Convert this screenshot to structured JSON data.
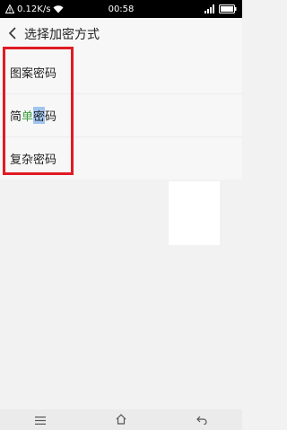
{
  "status_bar": {
    "speed": "0.12K/s",
    "time": "00:58"
  },
  "header": {
    "title": "选择加密方式"
  },
  "options": [
    {
      "label": "图案密码"
    },
    {
      "label_part1": "简",
      "label_part2": "单",
      "label_part3": "密",
      "label_part4": "码"
    },
    {
      "label": "复杂密码"
    }
  ],
  "colors": {
    "annotation_box": "#e01b24",
    "selection_highlight": "#9fc5f0"
  },
  "icons": {
    "back": "chevron-left-icon",
    "menu": "menu-icon",
    "home": "home-icon",
    "return": "return-icon"
  }
}
